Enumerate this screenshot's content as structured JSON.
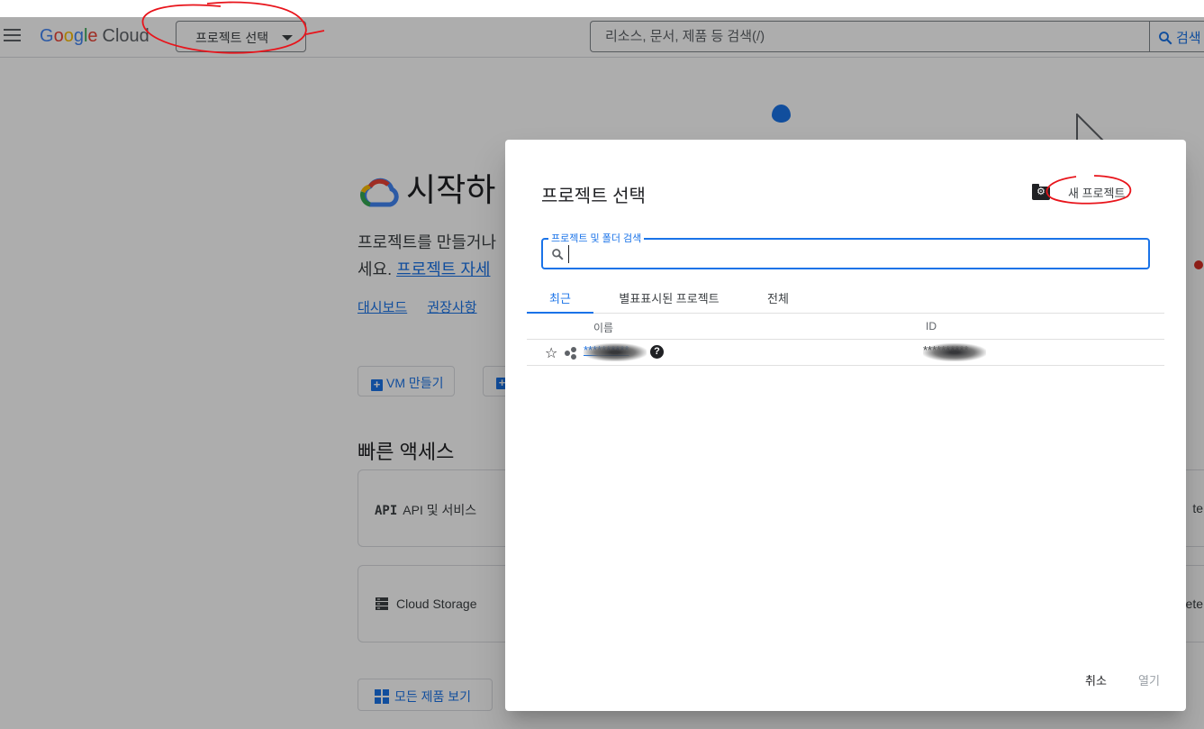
{
  "header": {
    "menu_icon": "hamburger-icon",
    "logo": {
      "G": "G",
      "o1": "o",
      "o2": "o",
      "g": "g",
      "l": "l",
      "e": "e",
      "product": "Cloud"
    },
    "project_picker_label": "프로젝트 선택",
    "search_placeholder": "리소스, 문서, 제품 등 검색(/)",
    "search_button_label": "검색"
  },
  "page": {
    "title": "시작하",
    "description_line1": "프로젝트를 만들거나",
    "description_line2_prefix": "세요. ",
    "description_link": "프로젝트 자세",
    "links": [
      "대시보드",
      "권장사항"
    ],
    "create_vm_label": "VM 만들기",
    "quick_access_title": "빠른 액세스",
    "cards": [
      {
        "icon_text": "API",
        "label": "API 및 서비스",
        "right_text": "te"
      },
      {
        "icon": "storage-icon",
        "label": "Cloud Storage",
        "right_text": "ete"
      }
    ],
    "all_products_label": "모든 제품 보기"
  },
  "dialog": {
    "title": "프로젝트 선택",
    "new_project_label": "새 프로젝트",
    "search_label": "프로젝트 및 폴더 검색",
    "search_value": "",
    "tabs": [
      {
        "label": "최근",
        "active": true
      },
      {
        "label": "별표표시된 프로젝트",
        "active": false
      },
      {
        "label": "전체",
        "active": false
      }
    ],
    "columns": {
      "name": "이름",
      "id": "ID"
    },
    "rows": [
      {
        "name": "**********",
        "id": "**********"
      }
    ],
    "cancel_label": "취소",
    "open_label": "열기"
  },
  "colors": {
    "accent": "#1a73e8",
    "overlay": "rgba(0,0,0,0.32)",
    "annotation": "#e8141b"
  }
}
